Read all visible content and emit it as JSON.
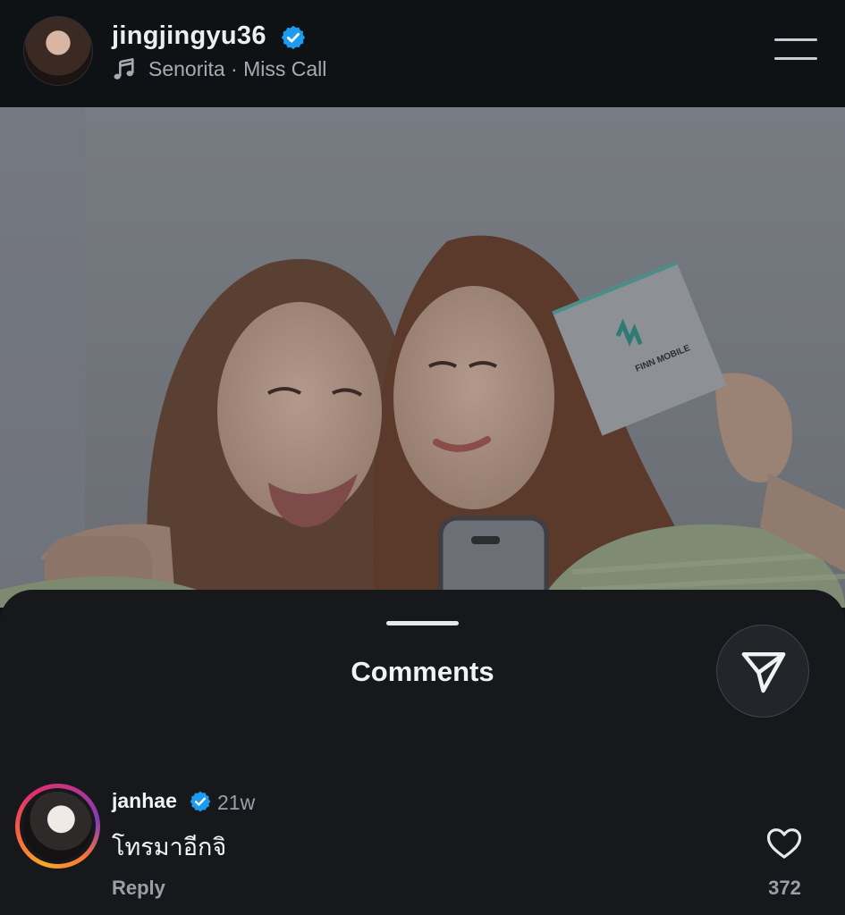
{
  "header": {
    "username": "jingjingyu36",
    "audio": "Senorita · Miss Call"
  },
  "photo": {
    "card_text": "FINN MOBILE"
  },
  "comments_sheet": {
    "title": "Comments"
  },
  "comments": [
    {
      "username": "janhae",
      "time": "21w",
      "text": "โทรมาอีกจิ",
      "reply_label": "Reply",
      "likes": "372"
    }
  ],
  "colors": {
    "verified": "#1d9bf0",
    "sheet_background": "#16181c",
    "header_background": "#0f1215"
  },
  "icons": [
    "verified-icon",
    "music-note-icon",
    "menu-icon",
    "send-icon",
    "heart-icon"
  ]
}
